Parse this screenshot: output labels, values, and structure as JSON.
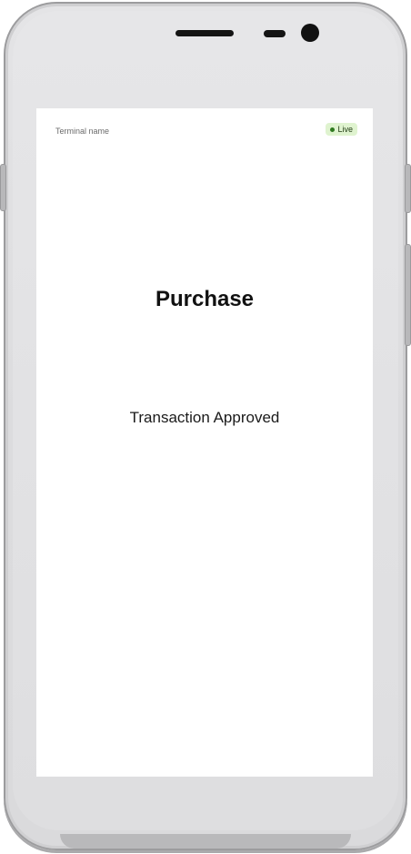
{
  "header": {
    "terminal_name": "Terminal name",
    "status_badge": {
      "label": "Live",
      "color": "#dff3cf",
      "dot_color": "#2f7a1f"
    }
  },
  "main": {
    "title": "Purchase",
    "status_message": "Transaction Approved"
  }
}
